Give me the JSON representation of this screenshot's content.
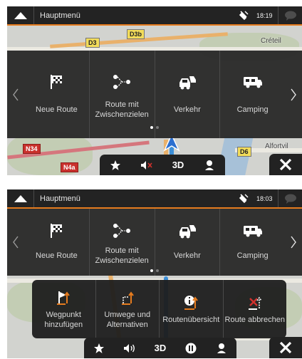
{
  "screen1": {
    "topbar": {
      "title": "Hauptmenü",
      "time": "18:19"
    },
    "menu_tiles": [
      {
        "icon": "checkered-flag-icon",
        "label": "Neue Route"
      },
      {
        "icon": "route-waypoints-icon",
        "label": "Route mit Zwischenzielen"
      },
      {
        "icon": "traffic-icon",
        "label": "Verkehr"
      },
      {
        "icon": "camper-icon",
        "label": "Camping"
      }
    ],
    "map_labels": {
      "d3": "D3",
      "d3b": "D3b",
      "n34": "N34",
      "n4a": "N4a",
      "d6": "D6",
      "creteil": "Créteil",
      "alfortville": "Alfortvil"
    },
    "toolbar": {
      "view_mode": "3D"
    }
  },
  "screen2": {
    "topbar": {
      "title": "Hauptmenü",
      "time": "18:03"
    },
    "menu_tiles": [
      {
        "icon": "checkered-flag-icon",
        "label": "Neue Route"
      },
      {
        "icon": "route-waypoints-icon",
        "label": "Route mit Zwischenzielen"
      },
      {
        "icon": "traffic-icon",
        "label": "Verkehr"
      },
      {
        "icon": "camper-icon",
        "label": "Camping"
      }
    ],
    "route_tiles": [
      {
        "icon": "add-waypoint-icon",
        "label": "Wegpunkt hinzufügen"
      },
      {
        "icon": "detour-icon",
        "label": "Umwege und Alternativen"
      },
      {
        "icon": "route-info-icon",
        "label": "Routenübersicht"
      },
      {
        "icon": "cancel-route-icon",
        "label": "Route abbrechen"
      }
    ],
    "toolbar": {
      "view_mode": "3D"
    }
  },
  "colors": {
    "accent": "#e57b1e",
    "panel": "#262626",
    "route": "#3c8fd8"
  }
}
